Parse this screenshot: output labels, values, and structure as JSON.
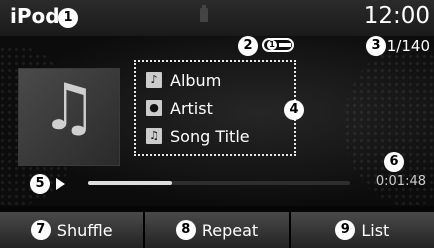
{
  "header": {
    "source_title": "iPod",
    "time": "12:00"
  },
  "callouts": [
    "1",
    "2",
    "3",
    "4",
    "5",
    "6",
    "7",
    "8",
    "9"
  ],
  "status": {
    "repeat_one": "1",
    "track_counter": "1/140"
  },
  "track_info": {
    "album": "Album",
    "artist": "Artist",
    "song_title": "Song Title"
  },
  "playback": {
    "elapsed": "0:01:48",
    "progress_fraction": 0.32
  },
  "buttons": {
    "shuffle": "Shuffle",
    "repeat": "Repeat",
    "list": "List"
  }
}
